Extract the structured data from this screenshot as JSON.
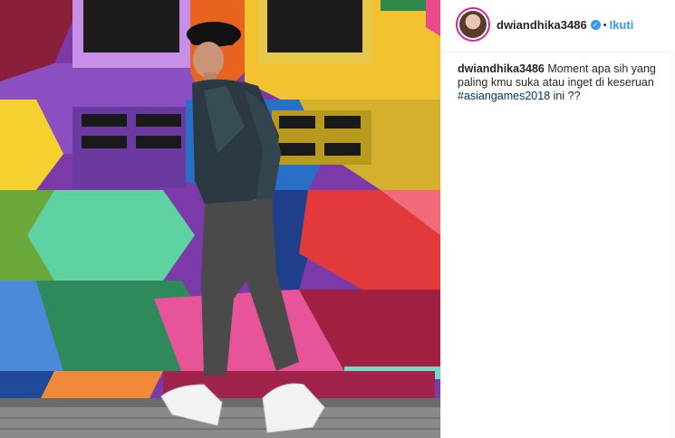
{
  "post": {
    "username": "dwiandhika3486",
    "verified_icon": "verified-badge-icon",
    "separator": "•",
    "follow_label": "Ikuti"
  },
  "caption": {
    "username": "dwiandhika3486",
    "text_before": " Moment apa sih yang paling kmu suka atau inget di keseruan ",
    "hashtag": "#asiangames2018",
    "text_after": " ini ??"
  },
  "colors": {
    "accent_blue": "#3897f0",
    "hashtag_blue": "#003569",
    "text": "#262626",
    "border": "#efefef"
  }
}
